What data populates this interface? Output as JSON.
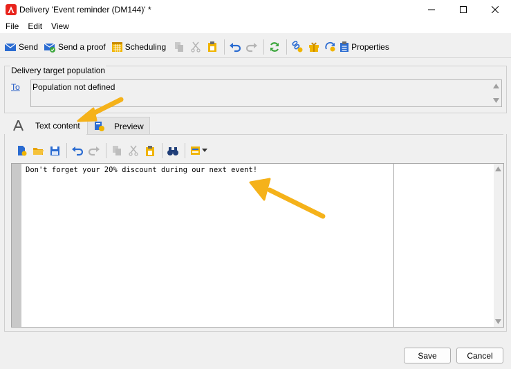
{
  "window": {
    "title": "Delivery 'Event reminder (DM144)' *",
    "controls": [
      "minimize",
      "maximize",
      "close"
    ]
  },
  "menu": {
    "items": [
      "File",
      "Edit",
      "View"
    ]
  },
  "toolbar": {
    "send_label": "Send",
    "send_proof_label": "Send a proof",
    "scheduling_label": "Scheduling",
    "properties_label": "Properties"
  },
  "target": {
    "group_label": "Delivery target population",
    "to_label": "To",
    "population_text": "Population not defined"
  },
  "tabs": [
    {
      "label": "Text content",
      "active": true
    },
    {
      "label": "Preview",
      "active": false
    }
  ],
  "editor": {
    "content": "Don't forget your 20% discount during our next event!"
  },
  "buttons": {
    "save": "Save",
    "cancel": "Cancel"
  },
  "colors": {
    "accent_arrow": "#f5b21a",
    "link": "#1a55c4",
    "icon_blue": "#2a6bd1",
    "icon_green": "#3aa53a",
    "icon_yellow": "#f0b400"
  }
}
